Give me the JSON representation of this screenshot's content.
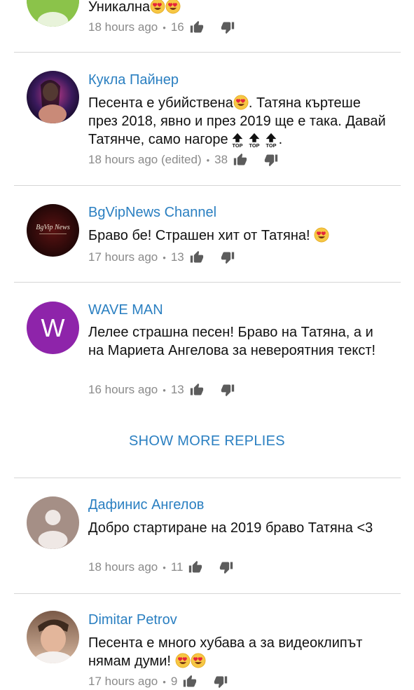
{
  "comments": [
    {
      "author": "",
      "text_before": "Уникална",
      "text_after": "",
      "emoji": [
        "smiling-heart-eyes",
        "smiling-heart-eyes"
      ],
      "time": "18 hours ago",
      "likes": "16"
    },
    {
      "author": "Кукла Пайнер",
      "text_before": "Песента е убийствена",
      "text_after": ". Татяна къртеше през 2018, явно и през 2019 ще е така. Давай Татянче, само нагоре",
      "tail": ".",
      "top_label": "TOP",
      "time": "18 hours ago (edited)",
      "likes": "38"
    },
    {
      "author": "BgVipNews Channel",
      "text_before": "Браво бе! Страшен хит от Татяна!",
      "text_after": "",
      "time": "17 hours ago",
      "likes": "13"
    },
    {
      "author": "WAVE MAN",
      "avatar_letter": "W",
      "text_before": "Лелее страшна песен! Браво на Татяна, а и на Мариета Ангелова за невероятния текст!",
      "text_after": "",
      "time": "16 hours ago",
      "likes": "13"
    },
    {
      "author": "Дафинис Ангелов",
      "text_before": "Добро стартиране на 2019 браво Татяна <3",
      "text_after": "",
      "time": "18 hours ago",
      "likes": "11"
    },
    {
      "author": "Dimitar Petrov",
      "text_before": "Песента е много хубава а за видеоклипът нямам думи!",
      "text_after": "",
      "time": "17 hours ago",
      "likes": "9"
    }
  ],
  "show_more_label": "SHOW MORE REPLIES",
  "avatar2_label": "BgVip News",
  "colors": {
    "link": "#2a7fc1",
    "meta": "#8a8a8a",
    "divider": "#d6d6d6",
    "wave_avatar": "#8e24aa",
    "default_avatar": "#a58f86"
  }
}
